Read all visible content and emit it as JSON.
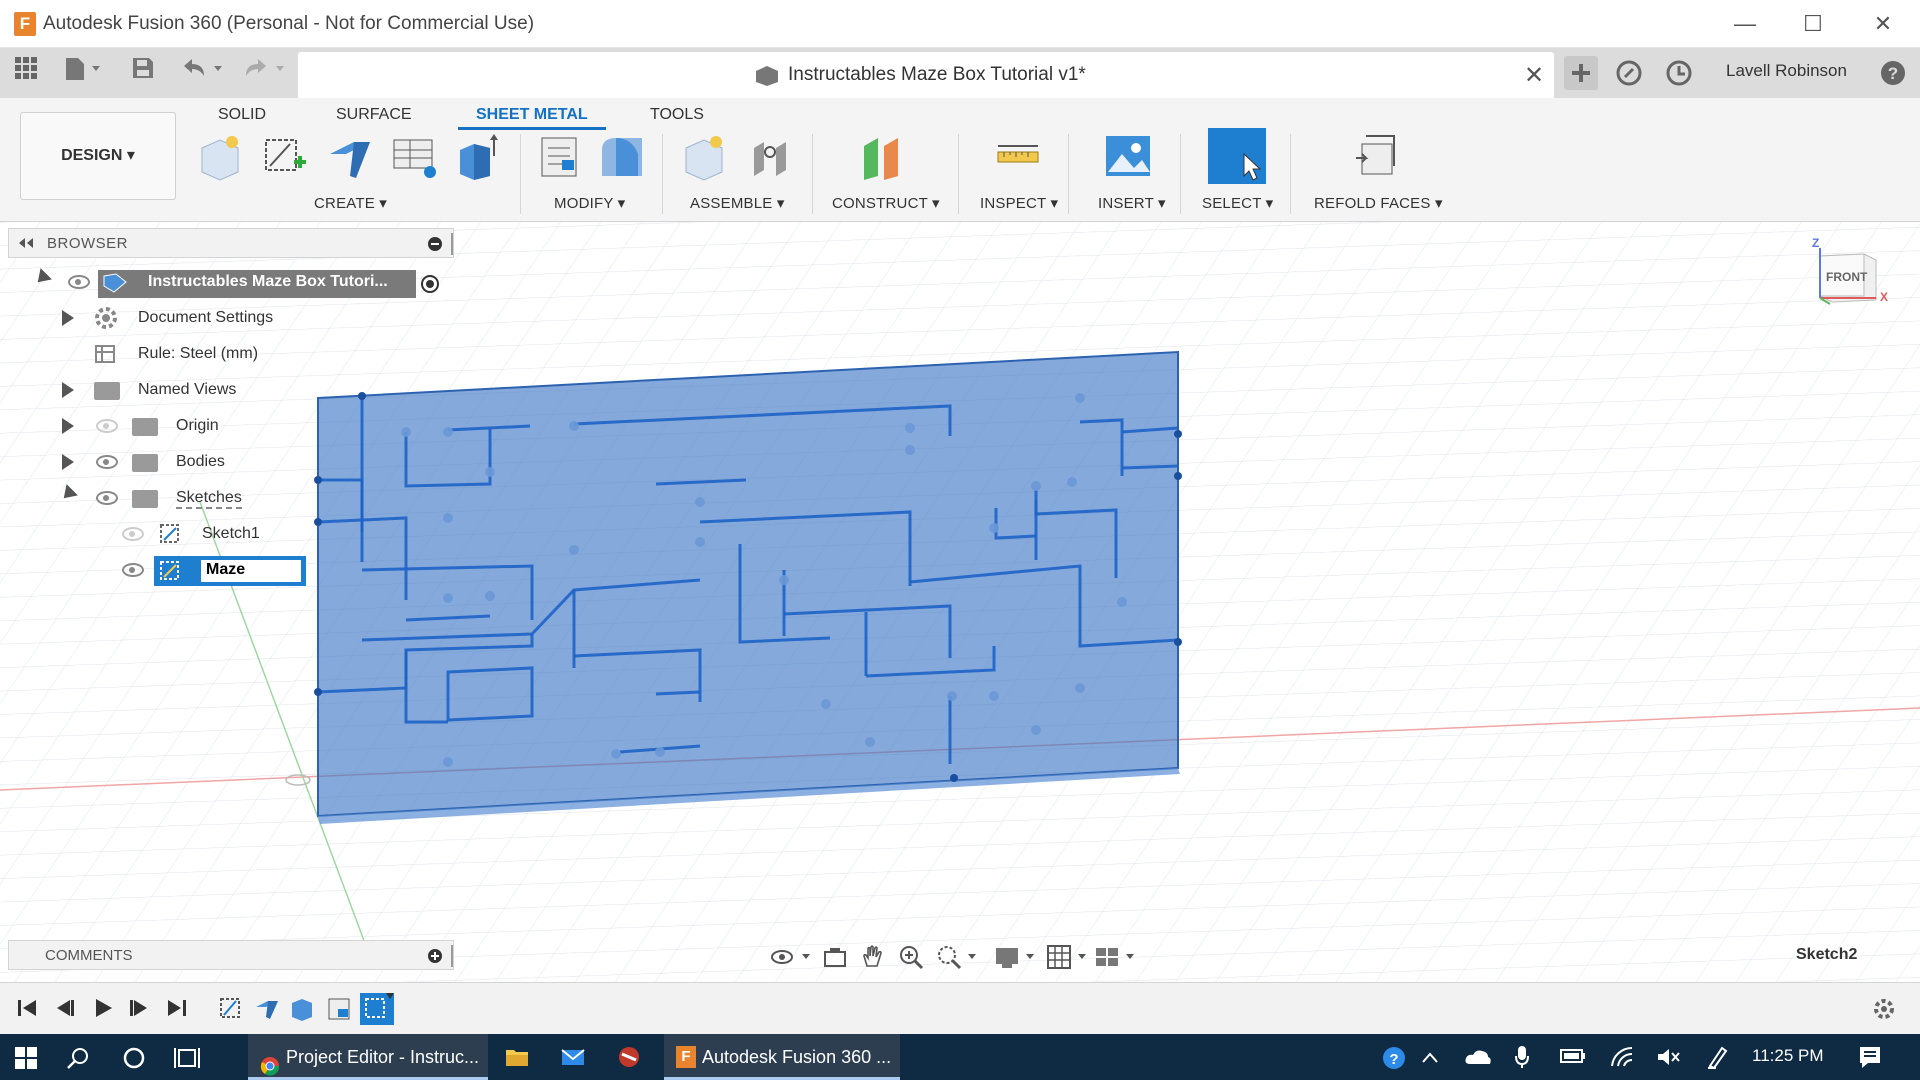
{
  "window": {
    "title": "Autodesk Fusion 360 (Personal - Not for Commercial Use)",
    "logo_letter": "F",
    "minimize": "—",
    "maximize": "☐",
    "close": "✕"
  },
  "document": {
    "title": "Instructables Maze Box Tutorial v1*",
    "close": "✕",
    "user": "Lavell Robinson"
  },
  "ribbon": {
    "workspace": "DESIGN ▾",
    "tabs": [
      "SOLID",
      "SURFACE",
      "SHEET METAL",
      "TOOLS"
    ],
    "active_tab": "SHEET METAL",
    "groups": {
      "create": "CREATE ▾",
      "modify": "MODIFY ▾",
      "assemble": "ASSEMBLE ▾",
      "construct": "CONSTRUCT ▾",
      "inspect": "INSPECT ▾",
      "insert": "INSERT ▾",
      "select": "SELECT ▾",
      "refold": "REFOLD FACES ▾"
    }
  },
  "browser": {
    "title": "BROWSER",
    "items": [
      {
        "label": "Instructables Maze Box Tutori..."
      },
      {
        "label": "Document Settings"
      },
      {
        "label": "Rule: Steel (mm)"
      },
      {
        "label": "Named Views"
      },
      {
        "label": "Origin"
      },
      {
        "label": "Bodies"
      },
      {
        "label": "Sketches"
      },
      {
        "label": "Sketch1"
      },
      {
        "label": "Maze"
      }
    ]
  },
  "viewcube": {
    "face": "FRONT",
    "axis_z": "Z",
    "axis_x": "X"
  },
  "comments": {
    "title": "COMMENTS"
  },
  "status": {
    "active_sketch": "Sketch2"
  },
  "taskbar": {
    "apps": [
      {
        "label": "Project Editor - Instruc..."
      },
      {
        "label": "Autodesk Fusion 360 ..."
      }
    ],
    "clock": "11:25 PM"
  },
  "colors": {
    "accent": "#1471c4",
    "maze_fill": "#3a74c4",
    "taskbar": "#0f2b44"
  }
}
